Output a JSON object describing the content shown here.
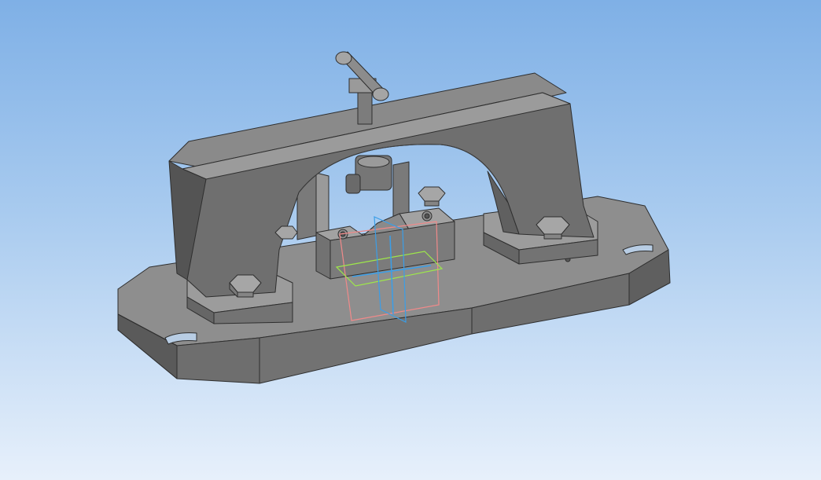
{
  "viewport": {
    "background_top": "#7fb0e6",
    "background_bottom": "#e7f0fb"
  },
  "model": {
    "part_color_light": "#9a9a9a",
    "part_color_mid": "#7d7d7d",
    "part_color_dark": "#5c5c5c",
    "edge_color": "#2e2e2e"
  },
  "origin_planes": {
    "front_plane_color": "#f08a8a",
    "top_plane_color": "#9ee84a",
    "right_plane_color": "#3a9ee8"
  }
}
